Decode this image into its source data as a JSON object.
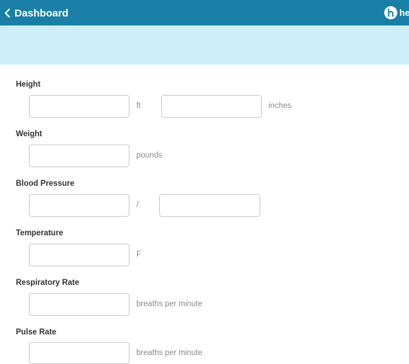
{
  "header": {
    "back_label": "Dashboard",
    "brand_text": "he"
  },
  "form": {
    "height": {
      "label": "Height",
      "feet_value": "",
      "feet_unit": "ft",
      "inches_value": "",
      "inches_unit": "inches"
    },
    "weight": {
      "label": "Weight",
      "value": "",
      "unit": "pounds"
    },
    "blood_pressure": {
      "label": "Blood Pressure",
      "systolic_value": "",
      "separator": "/",
      "diastolic_value": ""
    },
    "temperature": {
      "label": "Temperature",
      "value": "",
      "unit": "F"
    },
    "respiratory_rate": {
      "label": "Respiratory Rate",
      "value": "",
      "unit": "breaths per minute"
    },
    "pulse_rate": {
      "label": "Pulse Rate",
      "value": "",
      "unit": "breaths per minute"
    }
  },
  "colors": {
    "header_bg": "#1a7fa6",
    "banner_bg": "#cdeef8"
  }
}
